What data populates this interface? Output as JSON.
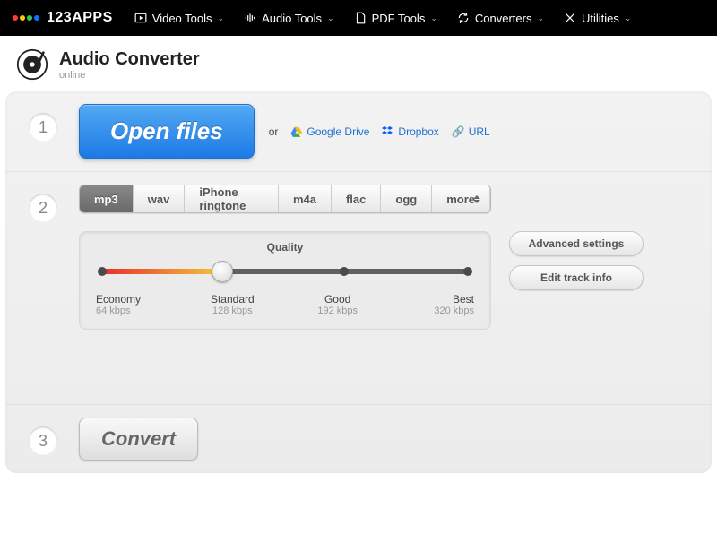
{
  "brand": "123APPS",
  "brand_colors": [
    "#ff3b30",
    "#ffcc00",
    "#34c759",
    "#007aff"
  ],
  "nav": [
    {
      "label": "Video Tools",
      "icon": "play"
    },
    {
      "label": "Audio Tools",
      "icon": "audio"
    },
    {
      "label": "PDF Tools",
      "icon": "doc"
    },
    {
      "label": "Converters",
      "icon": "convert"
    },
    {
      "label": "Utilities",
      "icon": "util"
    }
  ],
  "app": {
    "title": "Audio Converter",
    "subtitle": "online"
  },
  "step1": {
    "open_label": "Open files",
    "or": "or",
    "sources": [
      {
        "label": "Google Drive",
        "icon": "gdrive"
      },
      {
        "label": "Dropbox",
        "icon": "dropbox"
      },
      {
        "label": "URL",
        "icon": "link"
      }
    ]
  },
  "step2": {
    "formats": [
      "mp3",
      "wav",
      "iPhone ringtone",
      "m4a",
      "flac",
      "ogg"
    ],
    "more": "more",
    "active": "mp3",
    "quality_title": "Quality",
    "levels": [
      {
        "label": "Economy",
        "bitrate": "64 kbps"
      },
      {
        "label": "Standard",
        "bitrate": "128 kbps"
      },
      {
        "label": "Good",
        "bitrate": "192 kbps"
      },
      {
        "label": "Best",
        "bitrate": "320 kbps"
      }
    ],
    "selected_index": 1,
    "advanced": "Advanced settings",
    "edit_track": "Edit track info"
  },
  "step3": {
    "convert": "Convert"
  }
}
